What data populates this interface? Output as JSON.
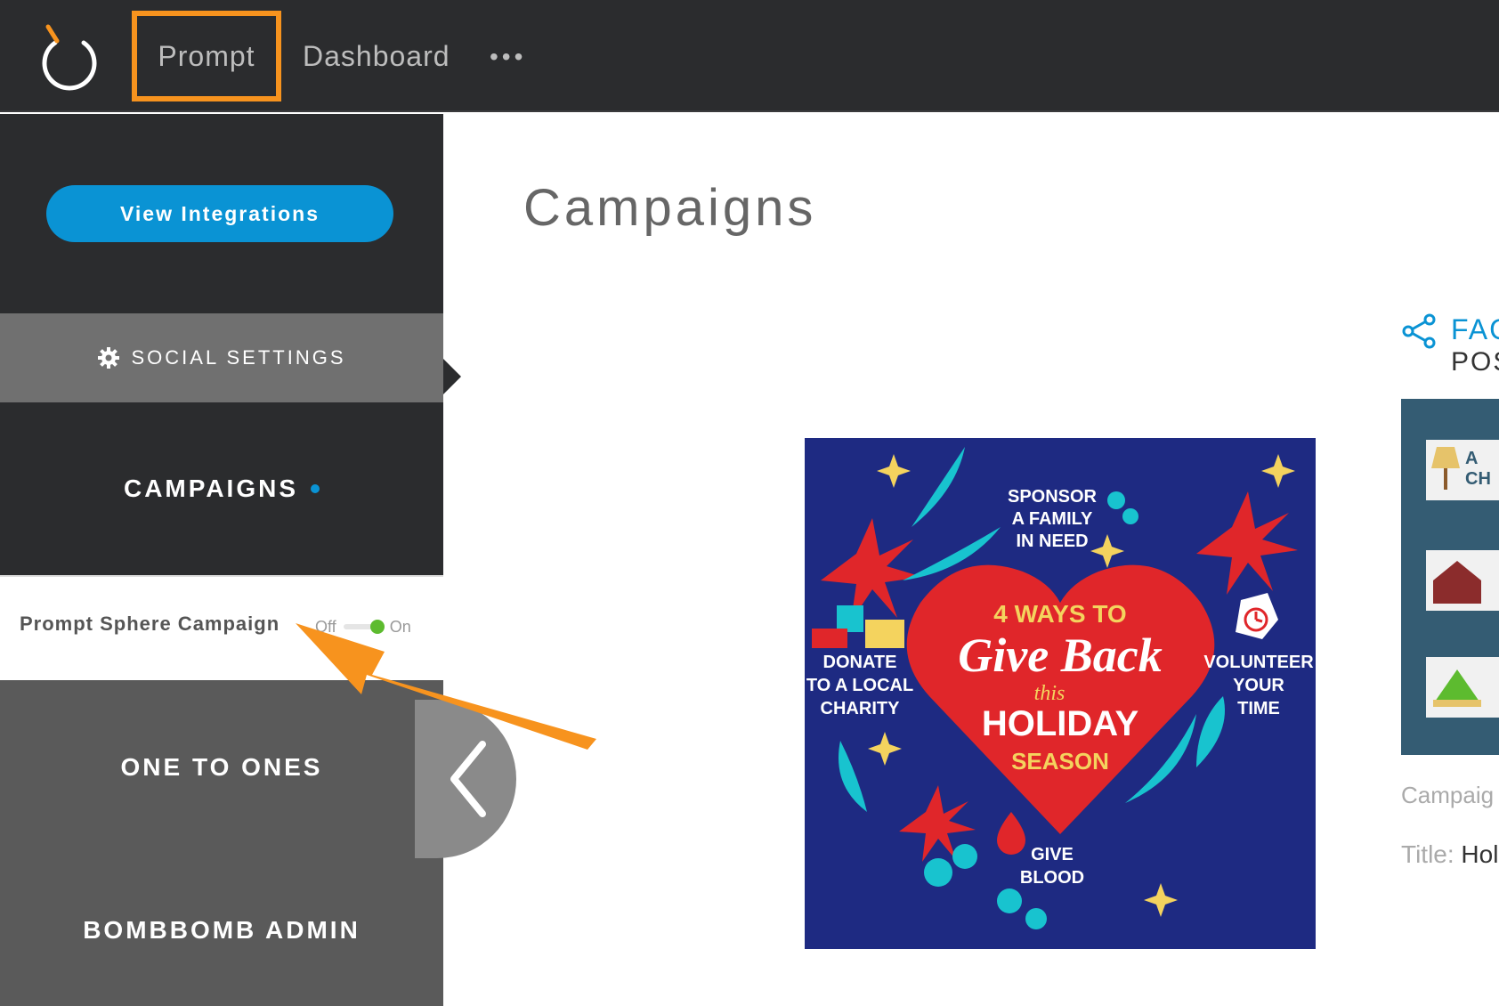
{
  "topbar": {
    "nav_prompt": "Prompt",
    "nav_dashboard": "Dashboard",
    "nav_more": "•••",
    "highlight_color": "#f7931e"
  },
  "sidebar": {
    "view_integrations": "View Integrations",
    "social_settings": "SOCIAL SETTINGS",
    "campaigns": "CAMPAIGNS",
    "campaign_item": {
      "name": "Prompt Sphere Campaign",
      "toggle_off": "Off",
      "toggle_on": "On",
      "state": "On"
    },
    "one_to_ones": "ONE TO ONES",
    "bombbomb_admin": "BOMBBOMB ADMIN"
  },
  "main": {
    "title": "Campaigns",
    "poster": {
      "top_text": [
        "SPONSOR",
        "A FAMILY",
        "IN NEED"
      ],
      "headline_1": "4 WAYS TO",
      "headline_2": "Give Back",
      "headline_3": "this",
      "headline_4": "HOLIDAY",
      "headline_5": "SEASON",
      "left_text": [
        "DONATE",
        "TO A LOCAL",
        "CHARITY"
      ],
      "right_text": [
        "VOLUNTEER",
        "YOUR",
        "TIME"
      ],
      "bottom_text": [
        "GIVE",
        "BLOOD"
      ]
    },
    "side_card": {
      "fac_label": "FAC",
      "pos_label": "POS",
      "campaign_label": "Campaig",
      "title_label": "Title:",
      "title_value": "Hol",
      "thumb_text": "A CH"
    }
  },
  "colors": {
    "accent_blue": "#0a93d4",
    "topbar_bg": "#2b2c2e",
    "poster_bg": "#1e2a82",
    "heart_red": "#e0262a",
    "toggle_green": "#5dbb2f"
  }
}
